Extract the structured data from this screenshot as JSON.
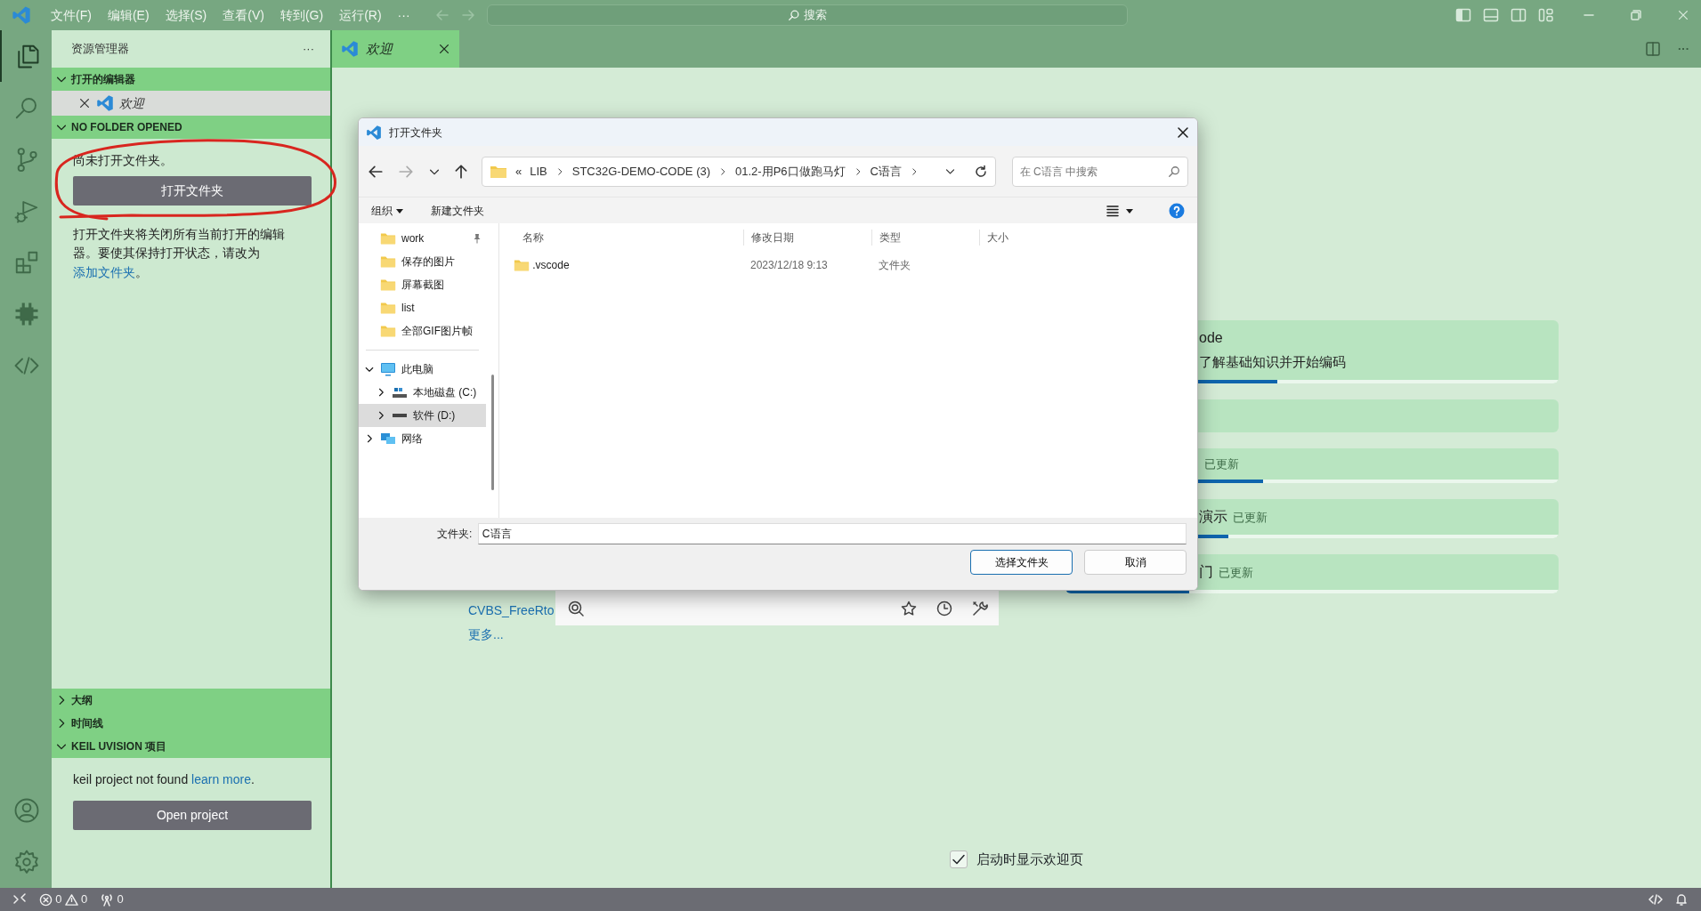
{
  "title_bar": {
    "menus": [
      "文件(F)",
      "编辑(E)",
      "选择(S)",
      "查看(V)",
      "转到(G)",
      "运行(R)"
    ],
    "more": "···",
    "search": {
      "placeholder": "搜索"
    }
  },
  "activity_bar": {
    "items": [
      {
        "kind": "files",
        "selected": true
      },
      {
        "kind": "search",
        "selected": false
      },
      {
        "kind": "branch",
        "selected": false
      },
      {
        "kind": "debug",
        "selected": false
      },
      {
        "kind": "extensions",
        "selected": false
      },
      {
        "kind": "chip",
        "selected": false
      },
      {
        "kind": "code",
        "selected": false
      }
    ]
  },
  "sidebar": {
    "title": "资源管理器",
    "more": "···",
    "sections": [
      {
        "kind": "editors",
        "title": "打开的编辑器",
        "expanded": true,
        "items": [
          {
            "label": "欢迎",
            "selected": true
          }
        ]
      },
      {
        "kind": "no-folder",
        "title": "NO FOLDER OPENED",
        "expanded": true,
        "message": "尚未打开文件夹。",
        "button": "打开文件夹",
        "note": "打开文件夹将关闭所有当前打开的编辑器。要使其保持打开状态，请改为 ",
        "link": "添加文件夹",
        "note_end": "。"
      },
      {
        "kind": "plain",
        "title": "大纲",
        "expanded": false
      },
      {
        "kind": "plain",
        "title": "时间线",
        "expanded": false
      },
      {
        "kind": "keil",
        "title": "KEIL UVISION 项目",
        "expanded": true,
        "message": "keil project not found ",
        "link": "learn more",
        "message_end": ".",
        "button": "Open project"
      }
    ]
  },
  "tabs": [
    {
      "label": "欢迎",
      "selected": true
    }
  ],
  "welcome": {
    "links": [
      "CVBS_FreeRto",
      "更多..."
    ],
    "cards": [
      {
        "kind": "progress",
        "title": "ode",
        "description": "了解基础知识并开始编码",
        "level": 0.43
      },
      {
        "kind": "blank"
      },
      {
        "kind": "progress",
        "badge": "已更新",
        "level": 0.4
      },
      {
        "kind": "progress",
        "title": "演示",
        "badge": "已更新",
        "level": 0.33
      },
      {
        "kind": "progress",
        "title": "门",
        "badge": "已更新",
        "level": 0.25
      }
    ],
    "show_on_startup": {
      "label": "启动时显示欢迎页",
      "checked": true
    }
  },
  "dialog": {
    "title": "打开文件夹",
    "overflow": "«",
    "breadcrumb": [
      "LIB",
      "STC32G-DEMO-CODE (3)",
      "01.2-用P6口做跑马灯",
      "C语言"
    ],
    "search": {
      "placeholder": "在 C语言 中搜索"
    },
    "commands": [
      "组织",
      "新建文件夹"
    ],
    "quick_access": [
      {
        "label": "work",
        "pinned": true
      },
      {
        "label": "保存的图片",
        "pinned": false
      },
      {
        "label": "屏幕截图",
        "pinned": false
      },
      {
        "label": "list",
        "pinned": false
      },
      {
        "label": "全部GIF图片帧",
        "pinned": false
      }
    ],
    "tree": [
      {
        "kind": "computer",
        "label": "此电脑",
        "expanded": true,
        "selected": false,
        "children": [
          {
            "kind": "disk",
            "label": "本地磁盘 (C:)",
            "expanded": false,
            "selected": false
          },
          {
            "kind": "drive",
            "label": "软件 (D:)",
            "expanded": false,
            "selected": true
          }
        ]
      },
      {
        "kind": "network",
        "label": "网络",
        "expanded": false,
        "selected": false
      }
    ],
    "columns": [
      "名称",
      "修改日期",
      "类型",
      "大小"
    ],
    "rows": [
      {
        "name": ".vscode",
        "modified": "2023/12/18 9:13",
        "type": "文件夹"
      }
    ],
    "folder_label": "文件夹:",
    "folder_value": "C语言",
    "buttons": [
      {
        "kind": "primary",
        "label": "选择文件夹"
      },
      {
        "kind": "secondary",
        "label": "取消"
      }
    ]
  },
  "status_bar": {
    "errors": "0",
    "warnings": "0",
    "ports": "0"
  }
}
